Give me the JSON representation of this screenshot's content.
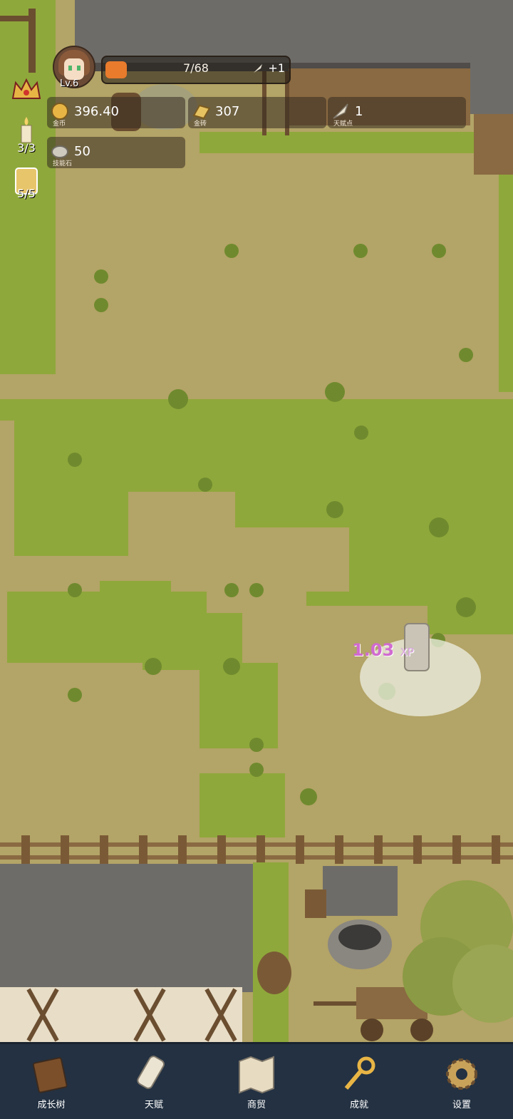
{
  "player": {
    "level": "Lv.6",
    "xp_text": "7/68",
    "xp_fraction": 0.103,
    "bonus": "+1"
  },
  "resources": [
    {
      "name": "gold",
      "value": "396.40",
      "label": "金币"
    },
    {
      "name": "gold-brick",
      "value": "307",
      "label": "金砖"
    },
    {
      "name": "talent-point",
      "value": "1",
      "label": "天赋点"
    },
    {
      "name": "skill-stone",
      "value": "50",
      "label": "技能石"
    }
  ],
  "side": {
    "candles": "3/3",
    "drinks": "5/5"
  },
  "floating": {
    "value": "1.03",
    "unit": "XP"
  },
  "nav": [
    {
      "label": "成长树",
      "icon": "book-icon"
    },
    {
      "label": "天赋",
      "icon": "scroll-icon"
    },
    {
      "label": "商贸",
      "icon": "map-icon"
    },
    {
      "label": "成就",
      "icon": "key-icon"
    },
    {
      "label": "设置",
      "icon": "gear-icon"
    }
  ]
}
